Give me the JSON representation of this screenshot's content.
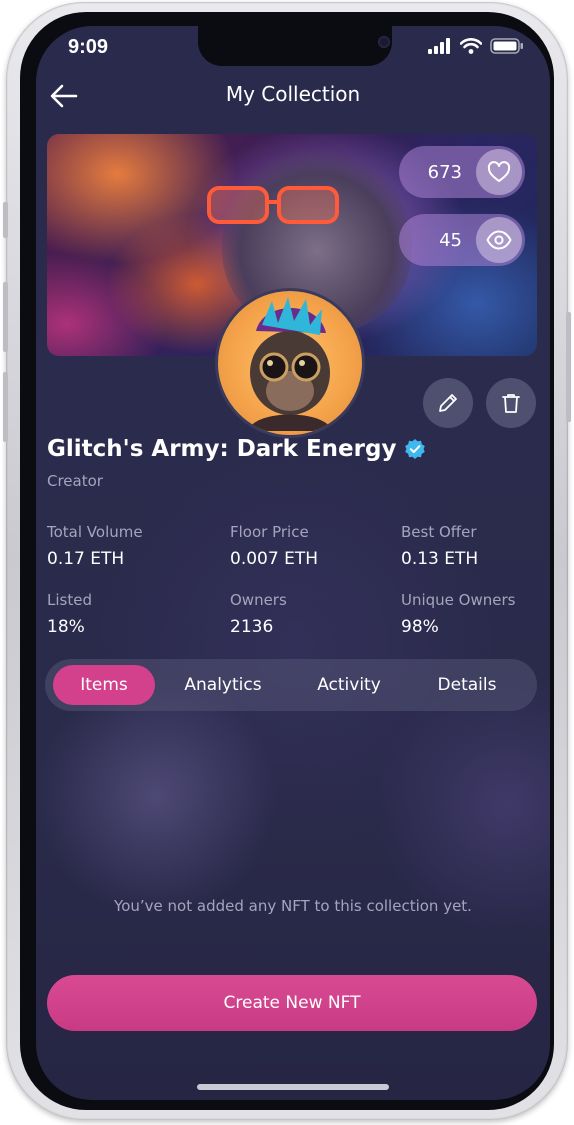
{
  "status_bar": {
    "time": "9:09"
  },
  "header": {
    "title": "My Collection"
  },
  "banner": {
    "likes": "673",
    "views": "45"
  },
  "collection": {
    "name": "Glitch's Army: Dark Energy",
    "role": "Creator"
  },
  "stats": [
    {
      "label": "Total Volume",
      "value": "0.17 ETH"
    },
    {
      "label": "Floor Price",
      "value": "0.007 ETH"
    },
    {
      "label": "Best Offer",
      "value": "0.13 ETH"
    },
    {
      "label": "Listed",
      "value": "18%"
    },
    {
      "label": "Owners",
      "value": "2136"
    },
    {
      "label": "Unique Owners",
      "value": "98%"
    }
  ],
  "tabs": [
    {
      "label": "Items",
      "active": true
    },
    {
      "label": "Analytics",
      "active": false
    },
    {
      "label": "Activity",
      "active": false
    },
    {
      "label": "Details",
      "active": false
    }
  ],
  "empty_state": {
    "message": "You’ve not added any NFT to this collection yet."
  },
  "actions": {
    "create_label": "Create New NFT"
  },
  "icons": {
    "back": "arrow-left-icon",
    "like": "heart-icon",
    "views": "eye-icon",
    "edit": "pencil-icon",
    "delete": "trash-icon",
    "verified": "verified-badge-icon",
    "signal": "cellular-signal-icon",
    "wifi": "wifi-icon",
    "battery": "battery-icon"
  },
  "colors": {
    "accent": "#d3418c",
    "background": "#2a2a4c",
    "verified": "#3fb8f0",
    "muted_text": "#a6a4bd"
  }
}
